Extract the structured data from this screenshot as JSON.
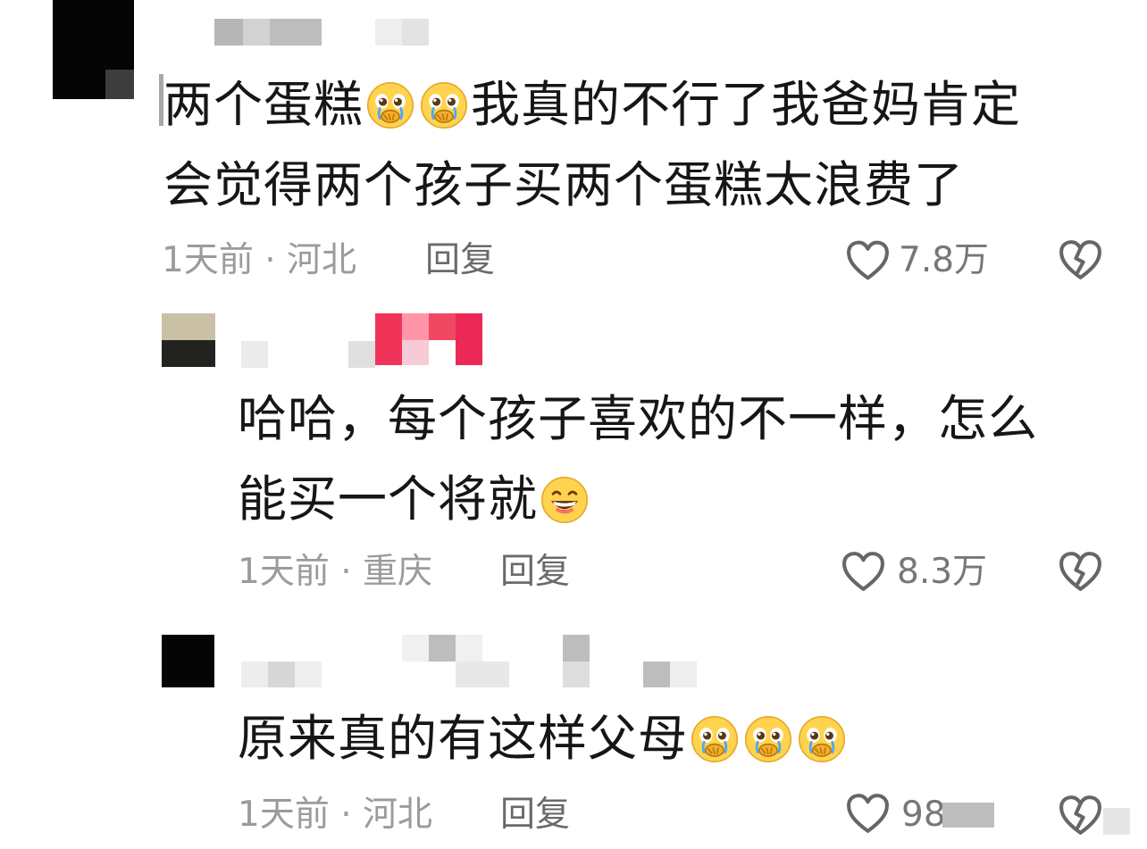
{
  "comments": [
    {
      "text_line_1_part_1": "两个蛋糕",
      "emoji_line_1": [
        "pleading-face-icon",
        "pleading-face-icon"
      ],
      "text_line_1_part_2": "我真的不行了我爸妈肯定",
      "text_line_2": "会觉得两个孩子买两个蛋糕太浪费了",
      "meta": "1天前 · 河北",
      "reply_label": "回复",
      "likes": "7.8万",
      "icons": [
        "heart-outline-icon",
        "broken-heart-icon"
      ]
    },
    {
      "text_line_1": "哈哈，每个孩子喜欢的不一样，怎么",
      "text_line_2": "能买一个将就",
      "emoji_line_2": "grinning-face-icon",
      "meta": "1天前 · 重庆",
      "reply_label": "回复",
      "likes": "8.3万",
      "icons": [
        "heart-outline-icon",
        "broken-heart-icon"
      ]
    },
    {
      "text": "原来真的有这样父母",
      "emoji_line_1": [
        "pleading-face-icon",
        "pleading-face-icon",
        "pleading-face-icon"
      ],
      "meta": "1天前 · 河北",
      "reply_label": "回复",
      "likes": "98",
      "icons": [
        "heart-outline-icon",
        "broken-heart-icon"
      ]
    }
  ],
  "colors": {
    "text": "#161616",
    "meta": "#9b9b9b",
    "reply": "#6a6a6a",
    "icon": "#666666",
    "emoji": "#ffd34d",
    "emoji_dark": "#b87810",
    "tear": "#48a9ff",
    "censor_pink": "#f03459"
  }
}
